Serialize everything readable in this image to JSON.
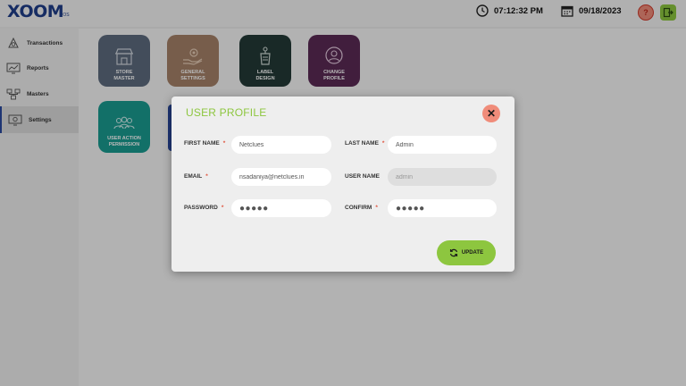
{
  "app": {
    "logo_text": "XOOM",
    "logo_sub": "POS",
    "time": "07:12:32 PM",
    "date": "09/18/2023",
    "help_symbol": "?",
    "colors": {
      "brand": "#1f3e8a",
      "accent_green": "#8dc63f",
      "danger": "#f08c7a"
    }
  },
  "sidebar": {
    "items": [
      {
        "label": "Transactions",
        "icon": "transactions-icon"
      },
      {
        "label": "Reports",
        "icon": "reports-icon"
      },
      {
        "label": "Masters",
        "icon": "masters-icon"
      },
      {
        "label": "Settings",
        "icon": "settings-icon",
        "active": true
      }
    ]
  },
  "tiles": [
    {
      "line1": "STORE",
      "line2": "MASTER",
      "color": "#5d6b7e",
      "icon": "store-icon"
    },
    {
      "line1": "GENERAL",
      "line2": "SETTINGS",
      "color": "#a58168",
      "icon": "gear-hand-icon"
    },
    {
      "line1": "LABEL",
      "line2": "DESIGN",
      "color": "#233a36",
      "icon": "label-icon"
    },
    {
      "line1": "CHANGE",
      "line2": "PROFILE",
      "color": "#5a2a55",
      "icon": "profile-icon"
    },
    {
      "line1": "USER ACTION",
      "line2": "PERMISSION",
      "color": "#1a9b91",
      "icon": "users-icon"
    }
  ],
  "modal": {
    "title": "USER PROFILE",
    "close_symbol": "✕",
    "fields": {
      "first_name": {
        "label": "FIRST NAME",
        "required": "*",
        "value": "Netclues"
      },
      "last_name": {
        "label": "LAST NAME",
        "required": "*",
        "value": "Admin"
      },
      "email": {
        "label": "EMAIL",
        "required": "*",
        "value": "nsadaniya@netclues.in"
      },
      "user_name": {
        "label": "USER NAME",
        "value": "admin"
      },
      "password": {
        "label": "PASSWORD",
        "required": "*",
        "value": "●●●●●"
      },
      "confirm": {
        "label": "CONFIRM",
        "required": "*",
        "value": "●●●●●"
      }
    },
    "update_label": "UPDATE"
  }
}
